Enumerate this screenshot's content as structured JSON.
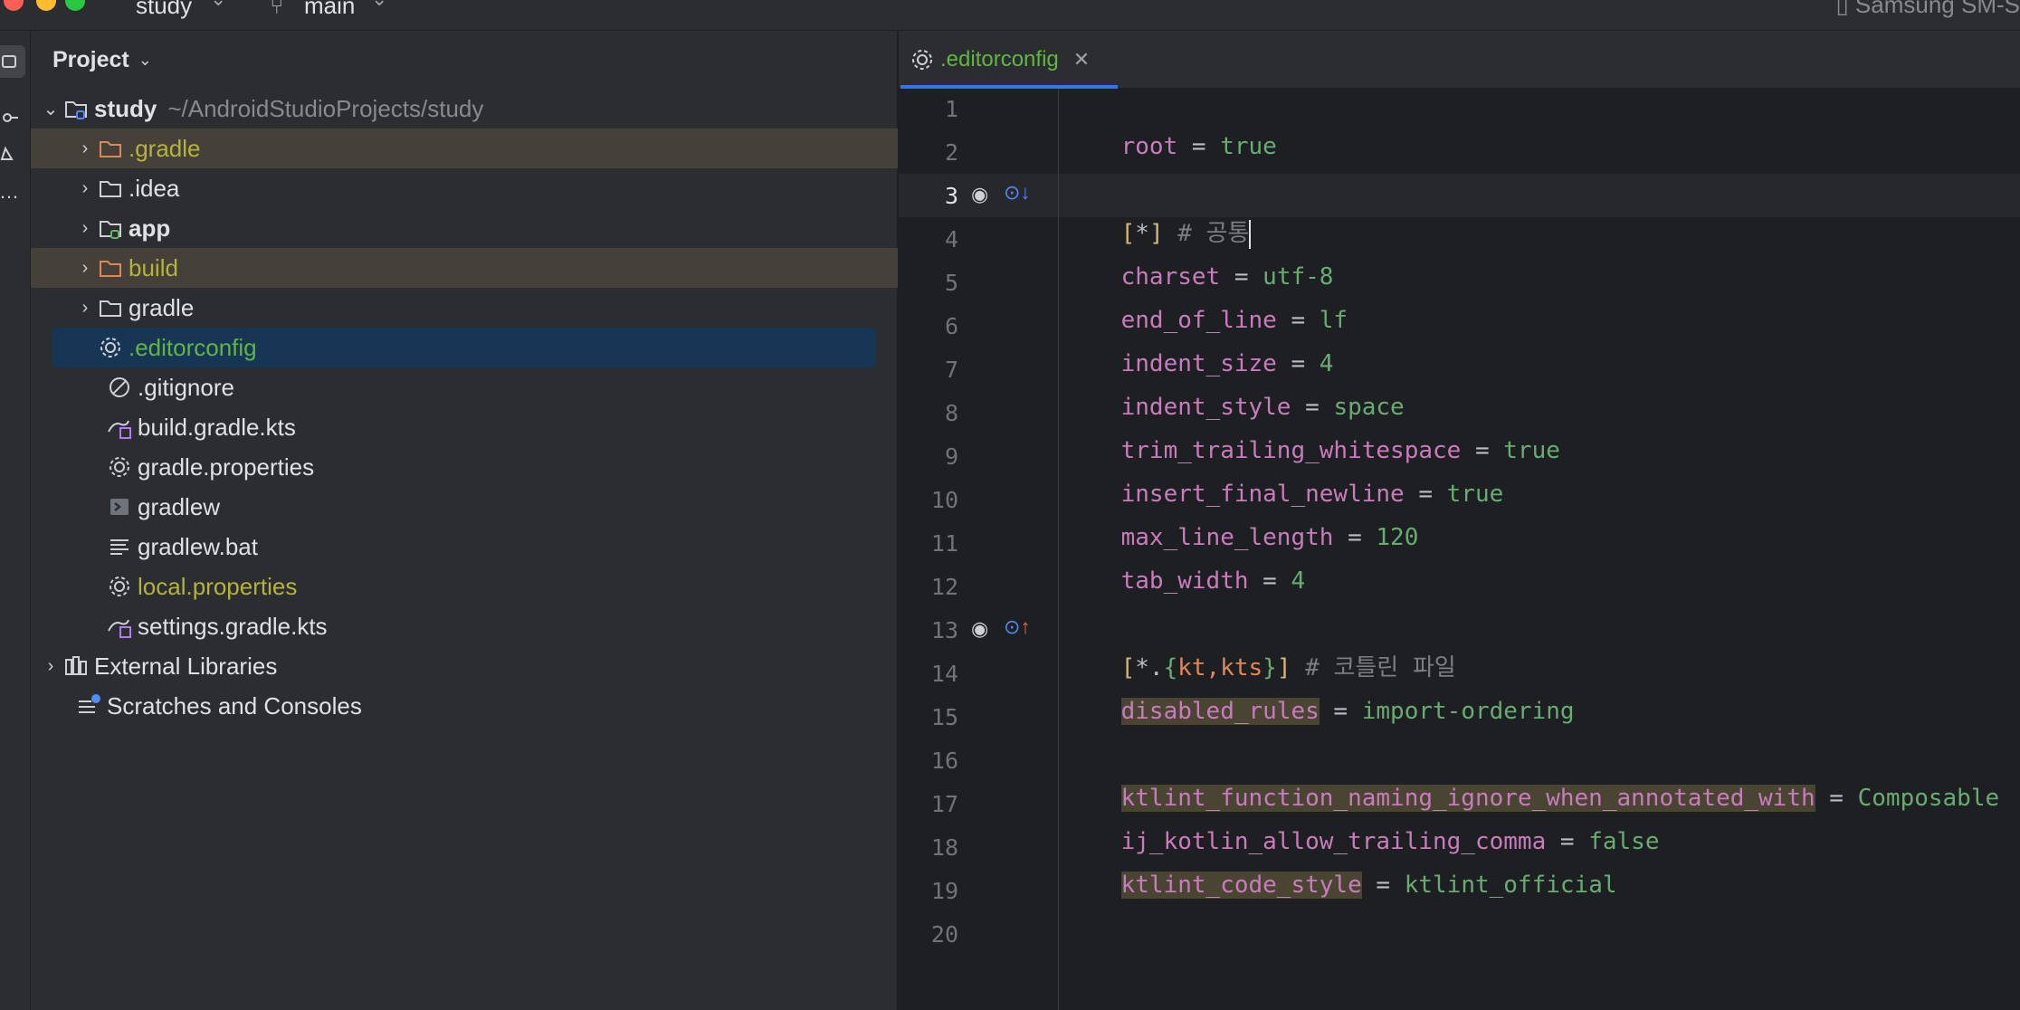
{
  "titlebar": {
    "project_name": "study",
    "branch": "main",
    "device": "Samsung SM-S"
  },
  "project_panel": {
    "title": "Project",
    "root": {
      "name": "study",
      "path": "~/AndroidStudioProjects/study"
    },
    "items": [
      {
        "label": ".gradle",
        "icon": "folder-icon"
      },
      {
        "label": ".idea",
        "icon": "folder-icon"
      },
      {
        "label": "app",
        "icon": "module-folder-icon"
      },
      {
        "label": "build",
        "icon": "folder-icon"
      },
      {
        "label": "gradle",
        "icon": "folder-icon"
      },
      {
        "label": ".editorconfig",
        "icon": "gear-icon"
      },
      {
        "label": ".gitignore",
        "icon": "ignore-icon"
      },
      {
        "label": "build.gradle.kts",
        "icon": "gradle-kts-icon"
      },
      {
        "label": "gradle.properties",
        "icon": "gear-icon"
      },
      {
        "label": "gradlew",
        "icon": "terminal-icon"
      },
      {
        "label": "gradlew.bat",
        "icon": "text-file-icon"
      },
      {
        "label": "local.properties",
        "icon": "gear-icon"
      },
      {
        "label": "settings.gradle.kts",
        "icon": "gradle-kts-icon"
      },
      {
        "label": "External Libraries",
        "icon": "libraries-icon"
      },
      {
        "label": "Scratches and Consoles",
        "icon": "scratches-icon"
      }
    ]
  },
  "editor": {
    "tab_label": ".editorconfig",
    "line_numbers": [
      "1",
      "2",
      "3",
      "4",
      "5",
      "6",
      "7",
      "8",
      "9",
      "10",
      "11",
      "12",
      "13",
      "14",
      "15",
      "16",
      "17",
      "18",
      "19",
      "20"
    ],
    "lines": {
      "l1": {
        "key": "root",
        "value": "true"
      },
      "l3": {
        "section": "*",
        "comment": "# 공통"
      },
      "l4": {
        "key": "charset",
        "value": "utf-8"
      },
      "l5": {
        "key": "end_of_line",
        "value": "lf"
      },
      "l6": {
        "key": "indent_size",
        "value": "4"
      },
      "l7": {
        "key": "indent_style",
        "value": "space"
      },
      "l8": {
        "key": "trim_trailing_whitespace",
        "value": "true"
      },
      "l9": {
        "key": "insert_final_newline",
        "value": "true"
      },
      "l10": {
        "key": "max_line_length",
        "value": "120"
      },
      "l11": {
        "key": "tab_width",
        "value": "4"
      },
      "l13": {
        "section_glob": "*.",
        "section_brace_open": "{",
        "section_exts": "kt,kts",
        "section_brace_close": "}",
        "comment": "# 코틀린 파일"
      },
      "l14": {
        "key": "disabled_rules",
        "value": "import-ordering"
      },
      "l16": {
        "key": "ktlint_function_naming_ignore_when_annotated_with",
        "value": "Composable"
      },
      "l17": {
        "key": "ij_kotlin_allow_trailing_comma",
        "value": "false"
      },
      "l18": {
        "key": "ktlint_code_style",
        "value": "ktlint_official"
      }
    }
  },
  "colors": {
    "accent": "#3574f0",
    "selection": "#173655",
    "excluded_highlight": "#45403a",
    "key": "#c77dbb",
    "value": "#6aab73"
  }
}
